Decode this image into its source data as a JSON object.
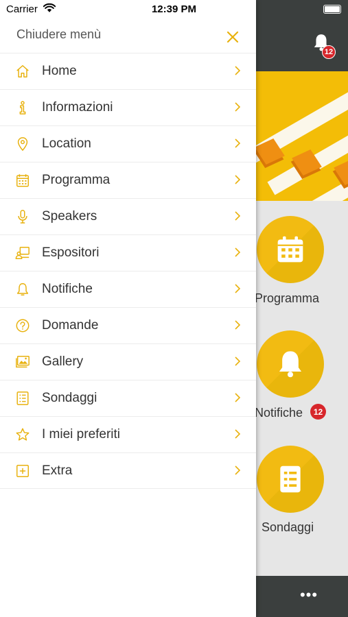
{
  "status_bar": {
    "carrier": "Carrier",
    "time": "12:39 PM"
  },
  "drawer": {
    "title": "Chiudere menù",
    "items": [
      {
        "label": "Home",
        "icon": "home-icon"
      },
      {
        "label": "Informazioni",
        "icon": "info-icon"
      },
      {
        "label": "Location",
        "icon": "location-pin-icon"
      },
      {
        "label": "Programma",
        "icon": "calendar-icon"
      },
      {
        "label": "Speakers",
        "icon": "microphone-icon"
      },
      {
        "label": "Espositori",
        "icon": "exhibitor-icon"
      },
      {
        "label": "Notifiche",
        "icon": "bell-icon"
      },
      {
        "label": "Domande",
        "icon": "question-icon"
      },
      {
        "label": "Gallery",
        "icon": "gallery-icon"
      },
      {
        "label": "Sondaggi",
        "icon": "checklist-icon"
      },
      {
        "label": "I miei preferiti",
        "icon": "star-icon"
      },
      {
        "label": "Extra",
        "icon": "plus-box-icon"
      }
    ]
  },
  "header": {
    "notification_count": "12"
  },
  "tiles": [
    {
      "label": "Programma",
      "icon": "calendar-icon"
    },
    {
      "label": "Notifiche",
      "icon": "bell-icon",
      "badge": "12"
    },
    {
      "label": "Sondaggi",
      "icon": "checklist-icon"
    }
  ],
  "bottom_bar": {
    "more": "•••"
  },
  "colors": {
    "accent": "#f2bb12",
    "header": "#3b3f3e",
    "badge": "#d7262b",
    "icon": "#e8b10d"
  }
}
